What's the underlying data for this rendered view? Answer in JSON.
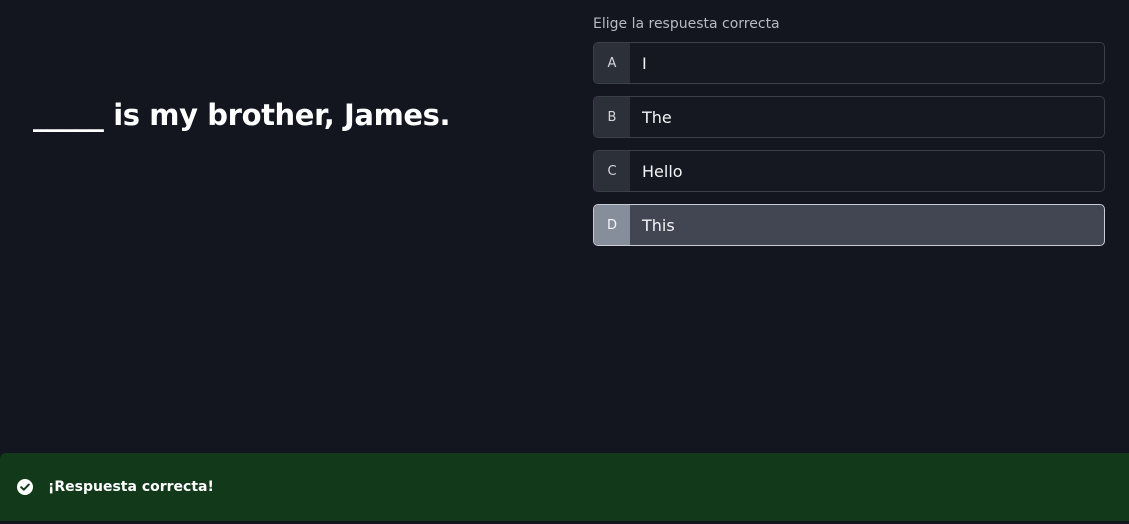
{
  "question": {
    "text": "_____ is my brother, James."
  },
  "answers": {
    "prompt": "Elige la respuesta correcta",
    "selected_index": 3,
    "options": [
      {
        "letter": "A",
        "text": "I"
      },
      {
        "letter": "B",
        "text": "The"
      },
      {
        "letter": "C",
        "text": "Hello"
      },
      {
        "letter": "D",
        "text": "This"
      }
    ]
  },
  "feedback": {
    "icon": "check-circle-icon",
    "message": "¡Respuesta correcta!",
    "color": "#12391a"
  }
}
